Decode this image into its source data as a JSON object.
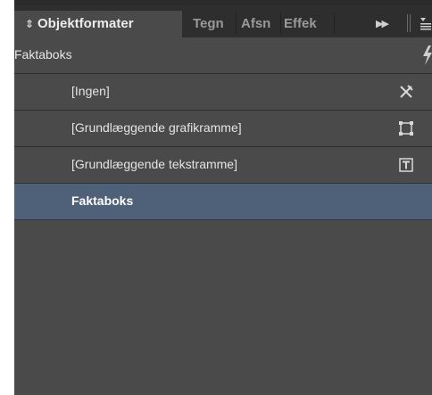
{
  "panel": {
    "tabs": [
      {
        "label": "Objektformater",
        "active": true
      },
      {
        "label": "Tegn",
        "active": false
      },
      {
        "label": "Afsn",
        "active": false
      },
      {
        "label": "Effek",
        "active": false
      }
    ],
    "current_style": "Faktaboks",
    "styles": [
      {
        "label": "[Ingen]",
        "icon": "no-style-icon"
      },
      {
        "label": "[Grundlæggende grafikramme]",
        "icon": "graphic-frame-icon"
      },
      {
        "label": "[Grundlæggende tekstramme]",
        "icon": "text-frame-icon"
      },
      {
        "label": "Faktaboks",
        "icon": null,
        "selected": true
      }
    ]
  },
  "colors": {
    "panel_bg": "#4a4a4a",
    "tabbar_bg": "#2e2e2e",
    "selection": "#4f6178",
    "text": "#e4e4e4"
  }
}
